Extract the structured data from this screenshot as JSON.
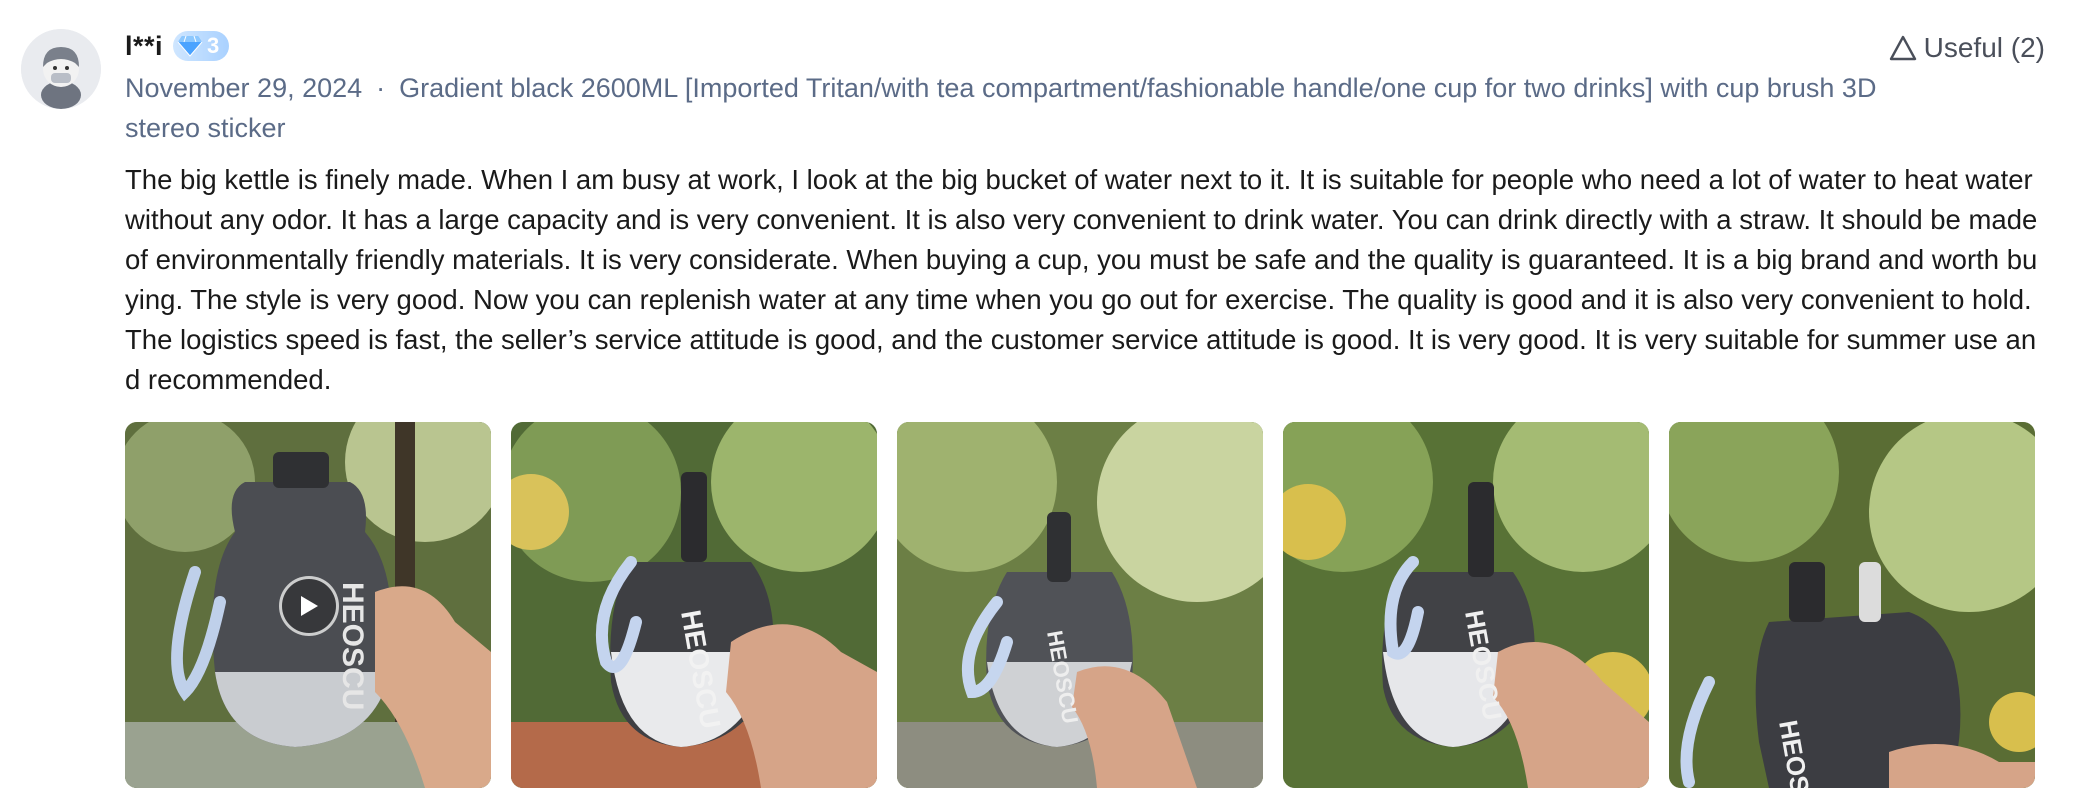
{
  "review": {
    "username": "l**i",
    "level": "3",
    "date": "November 29, 2024",
    "separator": "·",
    "variant": "Gradient black 2600ML [Imported Tritan/with tea compartment/fashionable handle/one cup for two drinks] with cup brush 3D stereo sticker",
    "useful_label": "Useful (2)",
    "text": "The big kettle is finely made. When I am busy at work, I look at the big bucket of water next to it. It is suitable for people who need a lot of water to heat water without any odor. It has a large capacity and is very convenient. It is also very convenient to drink water. You can drink directly with a straw. It should be made of environmentally friendly materials. It is very considerate. When buying a cup, you must be safe and the quality is guaranteed. It is a big brand and worth buying. The style is very good. Now you can replenish water at any time when you go out for exercise. The quality is good and it is also very convenient to hold. The logistics speed is fast, the seller’s service attitude is good, and the customer service attitude is good. It is very good. It is very suitable for summer use and recommended.",
    "media": [
      {
        "type": "video",
        "icon": "play-icon",
        "bottle_text": "HEOSCU"
      },
      {
        "type": "photo",
        "bottle_text": "HEOSCU"
      },
      {
        "type": "photo",
        "bottle_text": "HEOSCU"
      },
      {
        "type": "photo",
        "bottle_text": "HEOSCU"
      },
      {
        "type": "photo",
        "bottle_text": "HEOSCU"
      }
    ]
  },
  "colors": {
    "meta_text": "#5b6b87",
    "badge": "#a9d1ff",
    "useful_text": "#4a4f5a"
  }
}
